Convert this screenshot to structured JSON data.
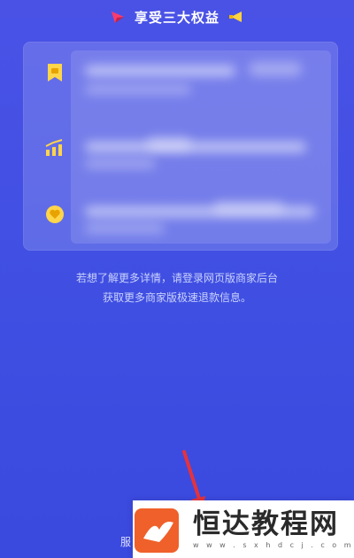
{
  "header": {
    "title": "享受三大权益",
    "icons": [
      "send-arrow-icon",
      "megaphone-icon"
    ],
    "colors": {
      "send": "#ff3b6b",
      "megaphone": "#ffd23f"
    }
  },
  "benefits": [
    {
      "icon": "badge-bookmark-icon"
    },
    {
      "icon": "growth-chart-icon"
    },
    {
      "icon": "heart-badge-icon"
    }
  ],
  "info": {
    "line1": "若想了解更多详情，请登录网页版商家后台",
    "line2": "获取更多商家版极速退款信息。"
  },
  "footer": {
    "text": "服"
  },
  "watermark": {
    "title": "恒达教程网",
    "url": "w w w . s x h d c j . c o m",
    "logo_color": "#f0602a"
  },
  "theme": {
    "background": "#4350e3",
    "icon_yellow": "#ffd54a",
    "arrow_red": "#e6323c"
  }
}
